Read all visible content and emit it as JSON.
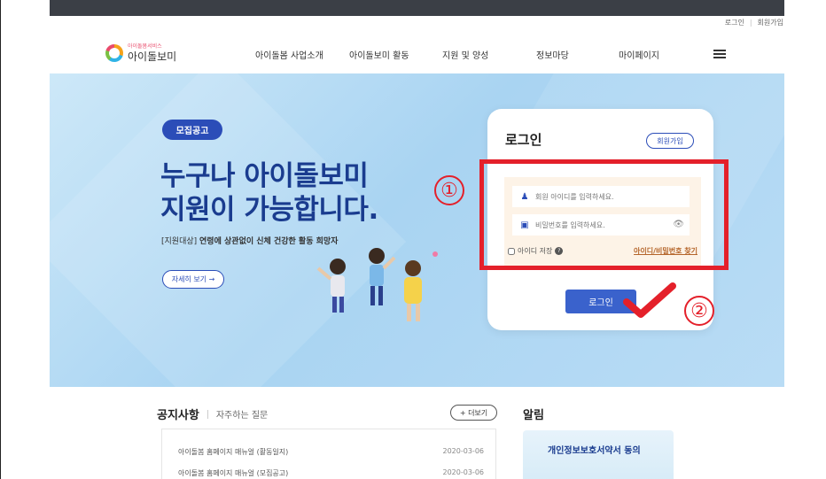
{
  "top_links": {
    "login": "로그인",
    "signup": "회원가입"
  },
  "logo": {
    "sub": "아이돌봄서비스",
    "main": "아이돌보미"
  },
  "nav": [
    "아이돌봄 사업소개",
    "아이돌보미 활동",
    "지원 및 양성",
    "정보마당",
    "마이페이지"
  ],
  "hero": {
    "badge": "모집공고",
    "title_line1": "누구나 아이돌보미",
    "title_line2": "지원이 가능합니다.",
    "target_label": "[지원대상]",
    "target_text": "연령에 상관없이 신체 건강한 활동 희망자",
    "more_button": "자세히 보기 →"
  },
  "login": {
    "title": "로그인",
    "signup_button": "회원가입",
    "id_placeholder": "회원 아이디를 입력하세요.",
    "pw_placeholder": "비밀번호를 입력하세요.",
    "save_id": "아이디 저장",
    "find_link": "아이디/비밀번호 찾기",
    "submit": "로그인"
  },
  "annotations": {
    "step1": "①",
    "step2": "②",
    "color": "#e4202a"
  },
  "notices": {
    "title": "공지사항",
    "faq": "자주하는 질문",
    "more": "+ 더보기",
    "items": [
      {
        "title": "아이돌봄 홈페이지 매뉴얼 (활동일지)",
        "date": "2020-03-06"
      },
      {
        "title": "아이돌봄 홈페이지 매뉴얼 (모집공고)",
        "date": "2020-03-06"
      }
    ]
  },
  "alerts": {
    "title": "알림",
    "banner": "개인정보보호서약서 동의"
  },
  "colors": {
    "brand": "#2b4db8",
    "button": "#3a62cc",
    "hero_bg": "#a9d4f2"
  }
}
